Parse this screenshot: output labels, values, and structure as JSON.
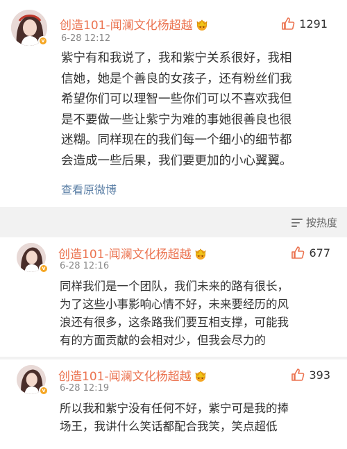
{
  "sort": {
    "label": "按热度",
    "icon": "sort-lines-icon"
  },
  "post": {
    "author": "创造101-闻澜文化杨超越",
    "time": "6-28 12:12",
    "likes": "1291",
    "text": "紫宁有和我说了，我和紫宁关系很好，我相\n信她，她是个善良的女孩子，还有粉丝们我\n希望你们可以理智一些你们可以不喜欢我但\n是不要做一些让紫宁为难的事她很善良也很\n迷糊。同样现在的我们每一个细小的细节都\n会造成一些后果，我们要更加的小心翼翼。",
    "view_original": "查看原微博"
  },
  "comments": [
    {
      "author": "创造101-闻澜文化杨超越",
      "time": "6-28 12:16",
      "likes": "677",
      "text": "同样我们是一个团队，我们未来的路有很长，\n为了这些小事影响心情不好，未来要经历的风\n浪还有很多，这条路我们要互相支撑，可能我\n有的方面贡献的会相对少，但我会尽力的"
    },
    {
      "author": "创造101-闻澜文化杨超越",
      "time": "6-28 12:19",
      "likes": "393",
      "text": "所以我和紫宁没有任何不好，紫宁可是我的捧\n场王，我讲什么笑话都配合我笑，笑点超低"
    }
  ],
  "colors": {
    "name": "#eb7350",
    "link": "#5b7fa6",
    "badge": "#f5a623",
    "background": "#f2f2f2"
  }
}
